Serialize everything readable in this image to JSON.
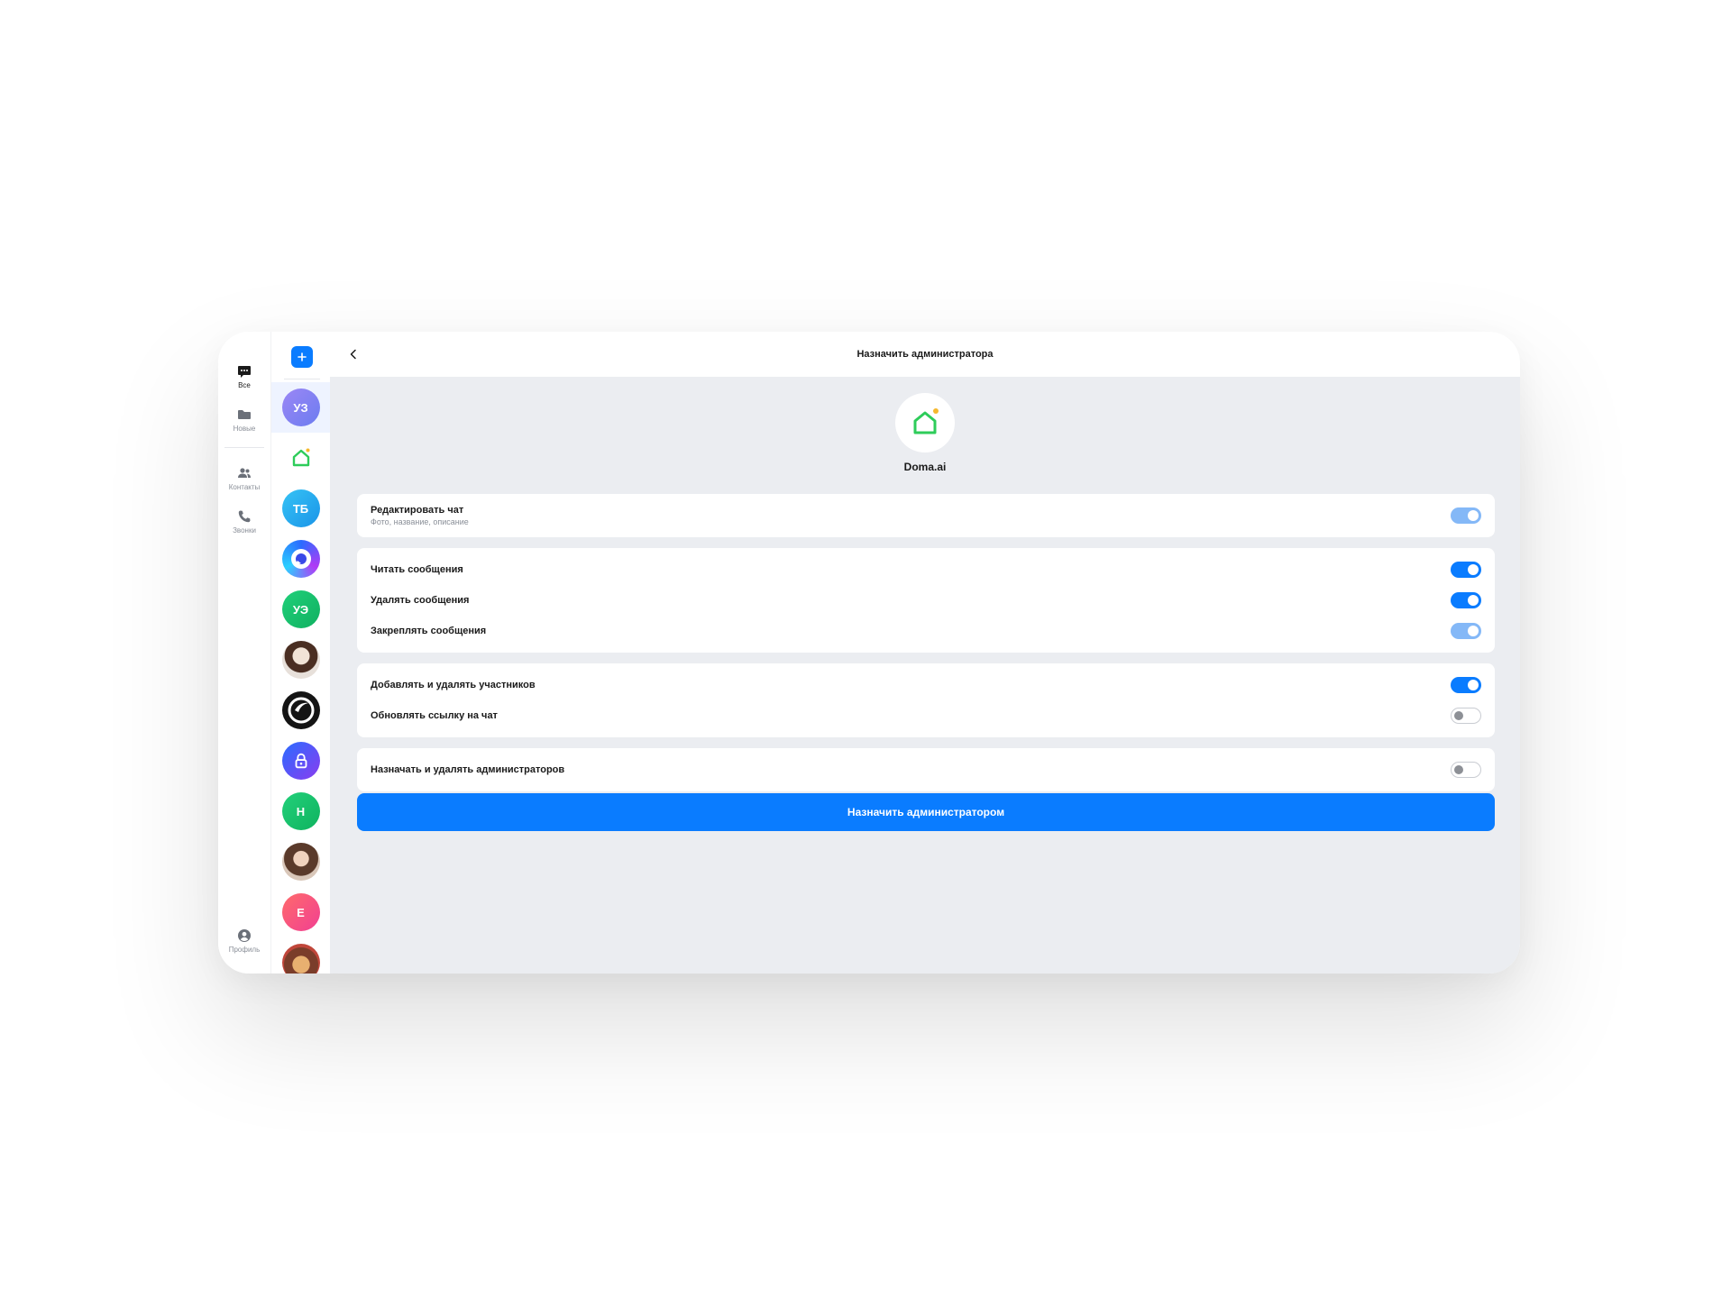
{
  "nav": {
    "items": [
      {
        "label": "Все",
        "icon": "chat-bubble-icon",
        "active": true
      },
      {
        "label": "Новые",
        "icon": "folder-icon",
        "active": false
      },
      {
        "label": "Контакты",
        "icon": "contacts-icon",
        "active": false
      },
      {
        "label": "Звонки",
        "icon": "phone-icon",
        "active": false
      }
    ],
    "profile_label": "Профиль"
  },
  "chats": [
    {
      "initials": "УЗ",
      "color": "#8b7cf6"
    },
    {
      "initials": "",
      "icon": "house-icon"
    },
    {
      "initials": "ТБ",
      "color": "#1eaaf1"
    },
    {
      "initials": "",
      "icon": "brand-ring-icon"
    },
    {
      "initials": "УЭ",
      "color": "#17c56e"
    },
    {
      "initials": "",
      "icon": "photo-avatar"
    },
    {
      "initials": "",
      "icon": "dark-logo-icon"
    },
    {
      "initials": "",
      "icon": "lock-icon"
    },
    {
      "initials": "Н",
      "color": "#19c36a"
    },
    {
      "initials": "",
      "icon": "photo-avatar"
    },
    {
      "initials": "Е",
      "color": "#ff5a7a"
    },
    {
      "initials": "",
      "icon": "photo-avatar"
    }
  ],
  "header": {
    "title": "Назначить администратора"
  },
  "group": {
    "name": "Doma.ai"
  },
  "permissions": {
    "edit_chat": {
      "label": "Редактировать чат",
      "sublabel": "Фото, название, описание",
      "state": "on-dim"
    },
    "read": {
      "label": "Читать сообщения",
      "state": "on"
    },
    "delete": {
      "label": "Удалять сообщения",
      "state": "on"
    },
    "pin": {
      "label": "Закреплять сообщения",
      "state": "on-dim"
    },
    "members": {
      "label": "Добавлять и удалять участников",
      "state": "on"
    },
    "link": {
      "label": "Обновлять ссылку на чат",
      "state": "off"
    },
    "admins": {
      "label": "Назначать и удалять администраторов",
      "state": "off"
    }
  },
  "actions": {
    "assign_label": "Назначить администратором"
  },
  "colors": {
    "accent": "#0a7cff",
    "accent_dim": "#84b8f7",
    "house_green": "#2ecc5a",
    "dot_yellow": "#f5b82e"
  }
}
